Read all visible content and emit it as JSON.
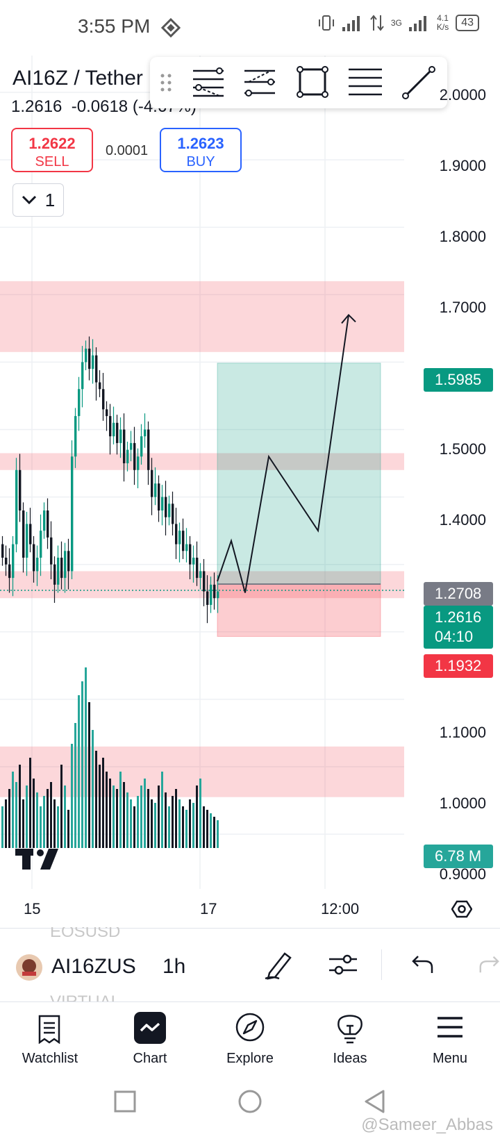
{
  "status_bar": {
    "time": "3:55 PM",
    "network_type": "3G",
    "net_speed": "4.1",
    "net_speed_unit": "K/s",
    "battery": "43"
  },
  "header": {
    "symbol": "AI16Z / Tether",
    "last_price": "1.2616",
    "change": "-0.0618",
    "change_pct": "(-4.67%)",
    "sell_price": "1.2622",
    "sell_label": "SELL",
    "spread": "0.0001",
    "buy_price": "1.2623",
    "buy_label": "BUY",
    "layout_count": "1"
  },
  "drawing_toolbar": {
    "tools": [
      "fib-retracement-icon",
      "trend-based-fib-icon",
      "rectangle-icon",
      "parallel-channel-icon",
      "trend-line-icon"
    ]
  },
  "price_axis": {
    "labels": [
      "2.0000",
      "1.9000",
      "1.8000",
      "1.7000",
      "1.5000",
      "1.4000",
      "1.1000",
      "1.0000",
      "0.9000"
    ],
    "tags": {
      "target": "1.5985",
      "entry": "1.2708",
      "current": "1.2616",
      "countdown": "04:10",
      "stop": "1.1932",
      "volume": "6.78 M"
    },
    "colors": {
      "target": "#089981",
      "entry": "#787b86",
      "current": "#089981",
      "stop": "#f23645",
      "volume": "#26a69a"
    }
  },
  "time_axis": {
    "labels": [
      "15",
      "17",
      "12:00"
    ]
  },
  "chart_data": {
    "type": "candlestick",
    "symbol": "AI16Z / Tether",
    "interval": "1h",
    "ylim": [
      0.87,
      2.02
    ],
    "price_labels": [
      2.0,
      1.9,
      1.8,
      1.7,
      1.6,
      1.5,
      1.4,
      1.3,
      1.2,
      1.1,
      1.0,
      0.9
    ],
    "close_series": [
      1.31,
      1.3,
      1.28,
      1.33,
      1.44,
      1.38,
      1.31,
      1.36,
      1.33,
      1.29,
      1.31,
      1.35,
      1.38,
      1.34,
      1.3,
      1.27,
      1.31,
      1.28,
      1.32,
      1.29,
      1.46,
      1.52,
      1.56,
      1.6,
      1.62,
      1.59,
      1.61,
      1.57,
      1.56,
      1.53,
      1.52,
      1.49,
      1.51,
      1.48,
      1.5,
      1.45,
      1.47,
      1.48,
      1.44,
      1.46,
      1.49,
      1.5,
      1.44,
      1.4,
      1.42,
      1.38,
      1.4,
      1.37,
      1.39,
      1.36,
      1.33,
      1.35,
      1.32,
      1.33,
      1.3,
      1.31,
      1.28,
      1.29,
      1.26,
      1.24,
      1.27,
      1.25,
      1.26
    ],
    "zones": [
      {
        "from": 1.615,
        "to": 1.72,
        "color": "#f23645"
      },
      {
        "from": 1.44,
        "to": 1.465,
        "color": "#f23645"
      },
      {
        "from": 1.25,
        "to": 1.29,
        "color": "#f23645"
      },
      {
        "from": 0.955,
        "to": 1.03,
        "color": "#f23645"
      }
    ],
    "position": {
      "entry": 1.2708,
      "target": 1.5985,
      "stop": 1.1932
    },
    "projection_path": [
      1.275,
      1.335,
      1.258,
      1.46,
      1.35,
      1.67
    ],
    "volume_last": "6.78 M"
  },
  "lower_toolbar": {
    "symbol_short": "AI16ZUS",
    "interval": "1h",
    "ghost_top": "EOSUSD",
    "ghost_bottom": "VIRTUAL"
  },
  "bottom_nav": {
    "items": [
      {
        "label": "Watchlist",
        "icon": "watchlist-icon"
      },
      {
        "label": "Chart",
        "icon": "chart-icon"
      },
      {
        "label": "Explore",
        "icon": "compass-icon"
      },
      {
        "label": "Ideas",
        "icon": "lightbulb-icon"
      },
      {
        "label": "Menu",
        "icon": "hamburger-icon"
      }
    ]
  },
  "watermark": "@Sameer_Abbas"
}
